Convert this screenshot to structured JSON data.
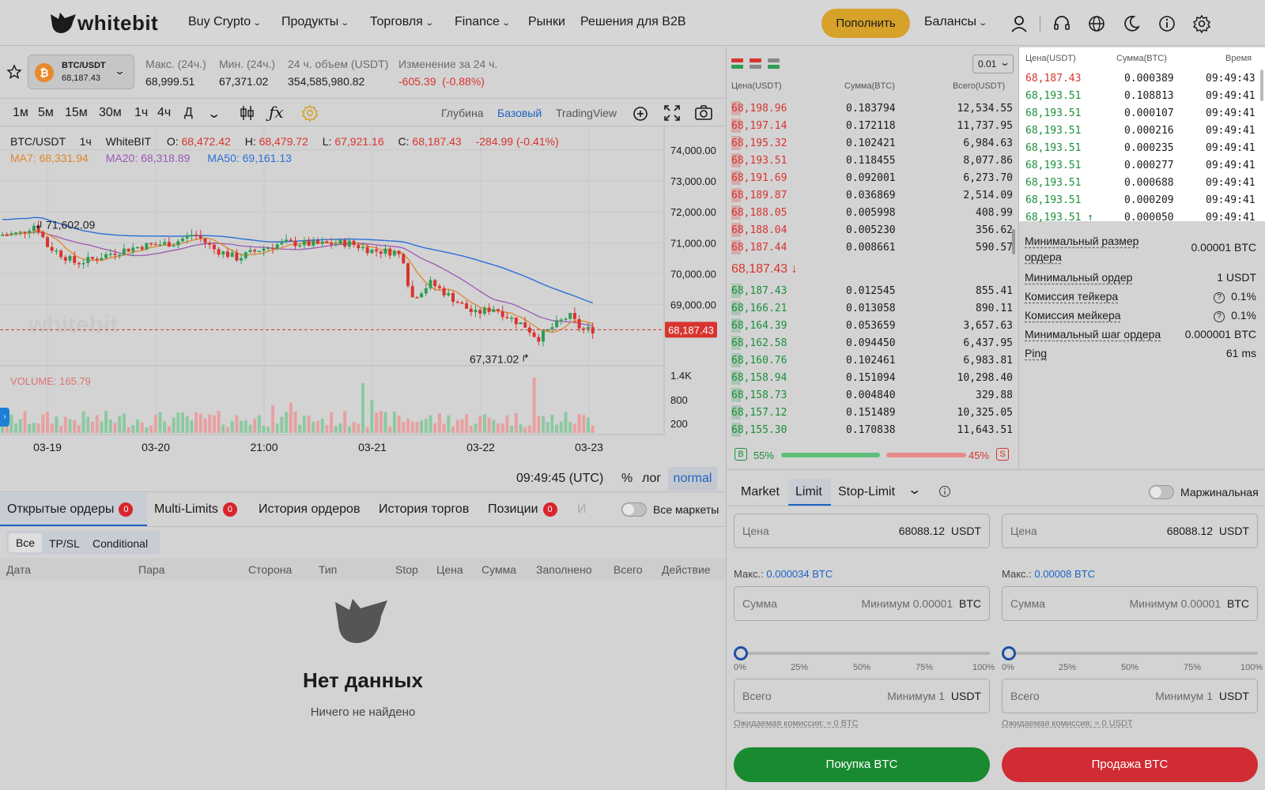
{
  "header": {
    "logo": "whitebit",
    "nav": [
      "Buy Crypto",
      "Продукты",
      "Торговля",
      "Finance",
      "Рынки",
      "Решения для B2B"
    ],
    "deposit": "Пополнить",
    "balances": "Балансы",
    "icons": [
      "user-icon",
      "headset-icon",
      "globe-icon",
      "moon-icon",
      "info-icon",
      "gear-icon"
    ]
  },
  "ticker": {
    "pair": "BTC/USDT",
    "price": "68,187.43",
    "stats": [
      {
        "label": "Макс. (24ч.)",
        "value": "68,999.51"
      },
      {
        "label": "Мин. (24ч.)",
        "value": "67,371.02"
      },
      {
        "label": "24 ч. объем (USDT)",
        "value": "354,585,980.82"
      },
      {
        "label": "Изменение за 24 ч.",
        "value": "-605.39  (-0.88%)"
      }
    ]
  },
  "chart_toolbar": {
    "intervals": [
      "1м",
      "5м",
      "15м",
      "30м",
      "1ч",
      "4ч",
      "Д"
    ],
    "active_interval": "1ч",
    "views": [
      "Глубина",
      "Базовый",
      "TradingView"
    ],
    "active_view": "Базовый"
  },
  "chart_data": {
    "type": "candlestick",
    "legend": {
      "pair": "BTC/USDT",
      "interval": "1ч",
      "exchange": "WhiteBIT",
      "O": "68,472.42",
      "H": "68,479.72",
      "L": "67,921.16",
      "C": "68,187.43",
      "change": "-284.99 (-0.41%)",
      "ma7": "MA7: 68,331.94",
      "ma20": "MA20: 68,318.89",
      "ma50": "MA50: 69,161.13"
    },
    "y_ticks": [
      "74,000.00",
      "73,000.00",
      "72,000.00",
      "71,000.00",
      "70,000.00",
      "69,000.00"
    ],
    "ylim": [
      67100,
      74300
    ],
    "last_price": "68,187.43",
    "high_marker": "71,602.09",
    "low_marker": "67,371.02",
    "volume_label": "VOLUME: 165.79",
    "volume_ticks": [
      "1.4K",
      "800",
      "200"
    ],
    "x_ticks": [
      "03-19",
      "03-20",
      "21:00",
      "03-21",
      "03-22",
      "03-23"
    ],
    "colors": {
      "up": "#2e9d55",
      "down": "#d8342f",
      "ma7": "#e0862a",
      "ma20": "#9b59b6",
      "ma50": "#2a6fd6"
    }
  },
  "chart_footer": {
    "time": "09:49:45 (UTC)",
    "pct": "%",
    "log": "лог",
    "mode": "normal"
  },
  "orderbook": {
    "precision": "0.01",
    "headers": [
      "Цена(USDT)",
      "Сумма(BTC)",
      "Всего(USDT)"
    ],
    "asks": [
      [
        "68,198.96",
        "0.183794",
        "12,534.55"
      ],
      [
        "68,197.14",
        "0.172118",
        "11,737.95"
      ],
      [
        "68,195.32",
        "0.102421",
        "6,984.63"
      ],
      [
        "68,193.51",
        "0.118455",
        "8,077.86"
      ],
      [
        "68,191.69",
        "0.092001",
        "6,273.70"
      ],
      [
        "68,189.87",
        "0.036869",
        "2,514.09"
      ],
      [
        "68,188.05",
        "0.005998",
        "408.99"
      ],
      [
        "68,188.04",
        "0.005230",
        "356.62"
      ],
      [
        "68,187.44",
        "0.008661",
        "590.57"
      ]
    ],
    "mid": "68,187.43 ↓",
    "bids": [
      [
        "68,187.43",
        "0.012545",
        "855.41"
      ],
      [
        "68,166.21",
        "0.013058",
        "890.11"
      ],
      [
        "68,164.39",
        "0.053659",
        "3,657.63"
      ],
      [
        "68,162.58",
        "0.094450",
        "6,437.95"
      ],
      [
        "68,160.76",
        "0.102461",
        "6,983.81"
      ],
      [
        "68,158.94",
        "0.151094",
        "10,298.40"
      ],
      [
        "68,158.73",
        "0.004840",
        "329.88"
      ],
      [
        "68,157.12",
        "0.151489",
        "10,325.05"
      ],
      [
        "68,155.30",
        "0.170838",
        "11,643.51"
      ]
    ],
    "buy_label": "B",
    "buy_pct": "55%",
    "sell_pct": "45%",
    "sell_label": "S"
  },
  "trades": {
    "headers": [
      "Цена(USDT)",
      "Сумма(BTC)",
      "Время"
    ],
    "rows": [
      {
        "price": "68,187.43",
        "amount": "0.000389",
        "time": "09:49:43",
        "side": "sell"
      },
      {
        "price": "68,193.51",
        "amount": "0.108813",
        "time": "09:49:41",
        "side": "buy"
      },
      {
        "price": "68,193.51",
        "amount": "0.000107",
        "time": "09:49:41",
        "side": "buy"
      },
      {
        "price": "68,193.51",
        "amount": "0.000216",
        "time": "09:49:41",
        "side": "buy"
      },
      {
        "price": "68,193.51",
        "amount": "0.000235",
        "time": "09:49:41",
        "side": "buy"
      },
      {
        "price": "68,193.51",
        "amount": "0.000277",
        "time": "09:49:41",
        "side": "buy"
      },
      {
        "price": "68,193.51",
        "amount": "0.000688",
        "time": "09:49:41",
        "side": "buy"
      },
      {
        "price": "68,193.51",
        "amount": "0.000209",
        "time": "09:49:41",
        "side": "buy"
      },
      {
        "price": "68,193.51 ↑",
        "amount": "0.000050",
        "time": "09:49:41",
        "side": "buy"
      }
    ]
  },
  "info": [
    {
      "label": "Минимальный размер ордера",
      "value": "0.00001 BTC"
    },
    {
      "label": "Минимальный ордер",
      "value": "1 USDT"
    },
    {
      "label": "Комиссия тейкера",
      "value": "0.1%"
    },
    {
      "label": "Комиссия мейкера",
      "value": "0.1%"
    },
    {
      "label": "Минимальный шаг ордера",
      "value": "0.000001 BTC"
    },
    {
      "label": "Ping",
      "value": "61 ms"
    }
  ],
  "order_form": {
    "tabs": [
      "Market",
      "Limit",
      "Stop-Limit"
    ],
    "active_tab": "Limit",
    "margin_label": "Маржинальная",
    "buy": {
      "price_label": "Цена",
      "price_value": "68088.12",
      "price_unit": "USDT",
      "max_label": "Макс.:",
      "max_value": "0.000034 BTC",
      "amount_label": "Сумма",
      "amount_placeholder": "Минимум 0.00001",
      "amount_unit": "BTC",
      "total_label": "Всего",
      "total_placeholder": "Минимум 1",
      "total_unit": "USDT",
      "fee": "Ожидаемая комиссия: ≈ 0 BTC",
      "button": "Покупка BTC"
    },
    "sell": {
      "price_label": "Цена",
      "price_value": "68088.12",
      "price_unit": "USDT",
      "max_label": "Макс.:",
      "max_value": "0.00008 BTC",
      "amount_label": "Сумма",
      "amount_placeholder": "Минимум 0.00001",
      "amount_unit": "BTC",
      "total_label": "Всего",
      "total_placeholder": "Минимум 1",
      "total_unit": "USDT",
      "fee": "Ожидаемая комиссия: ≈ 0 USDT",
      "button": "Продажа BTC"
    },
    "slider_ticks": [
      "0%",
      "25%",
      "50%",
      "75%",
      "100%"
    ],
    "slider_value_pct": 0,
    "buy_color": "#1a8a30",
    "sell_color": "#d12b33"
  },
  "orders": {
    "tabs": [
      {
        "label": "Открытые ордеры",
        "badge": "0"
      },
      {
        "label": "Multi-Limits",
        "badge": "0"
      },
      {
        "label": "История ордеров"
      },
      {
        "label": "История торгов"
      },
      {
        "label": "Позиции",
        "badge": "0"
      },
      {
        "label": "И"
      }
    ],
    "all_markets": "Все маркеты",
    "filters": [
      "Все",
      "TP/SL",
      "Conditional"
    ],
    "columns": [
      "Дата",
      "Пара",
      "Сторона",
      "Тип",
      "Stop",
      "Цена",
      "Сумма",
      "Заполнено",
      "Всего",
      "Действие"
    ],
    "empty_title": "Нет данных",
    "empty_sub": "Ничего не найдено"
  }
}
